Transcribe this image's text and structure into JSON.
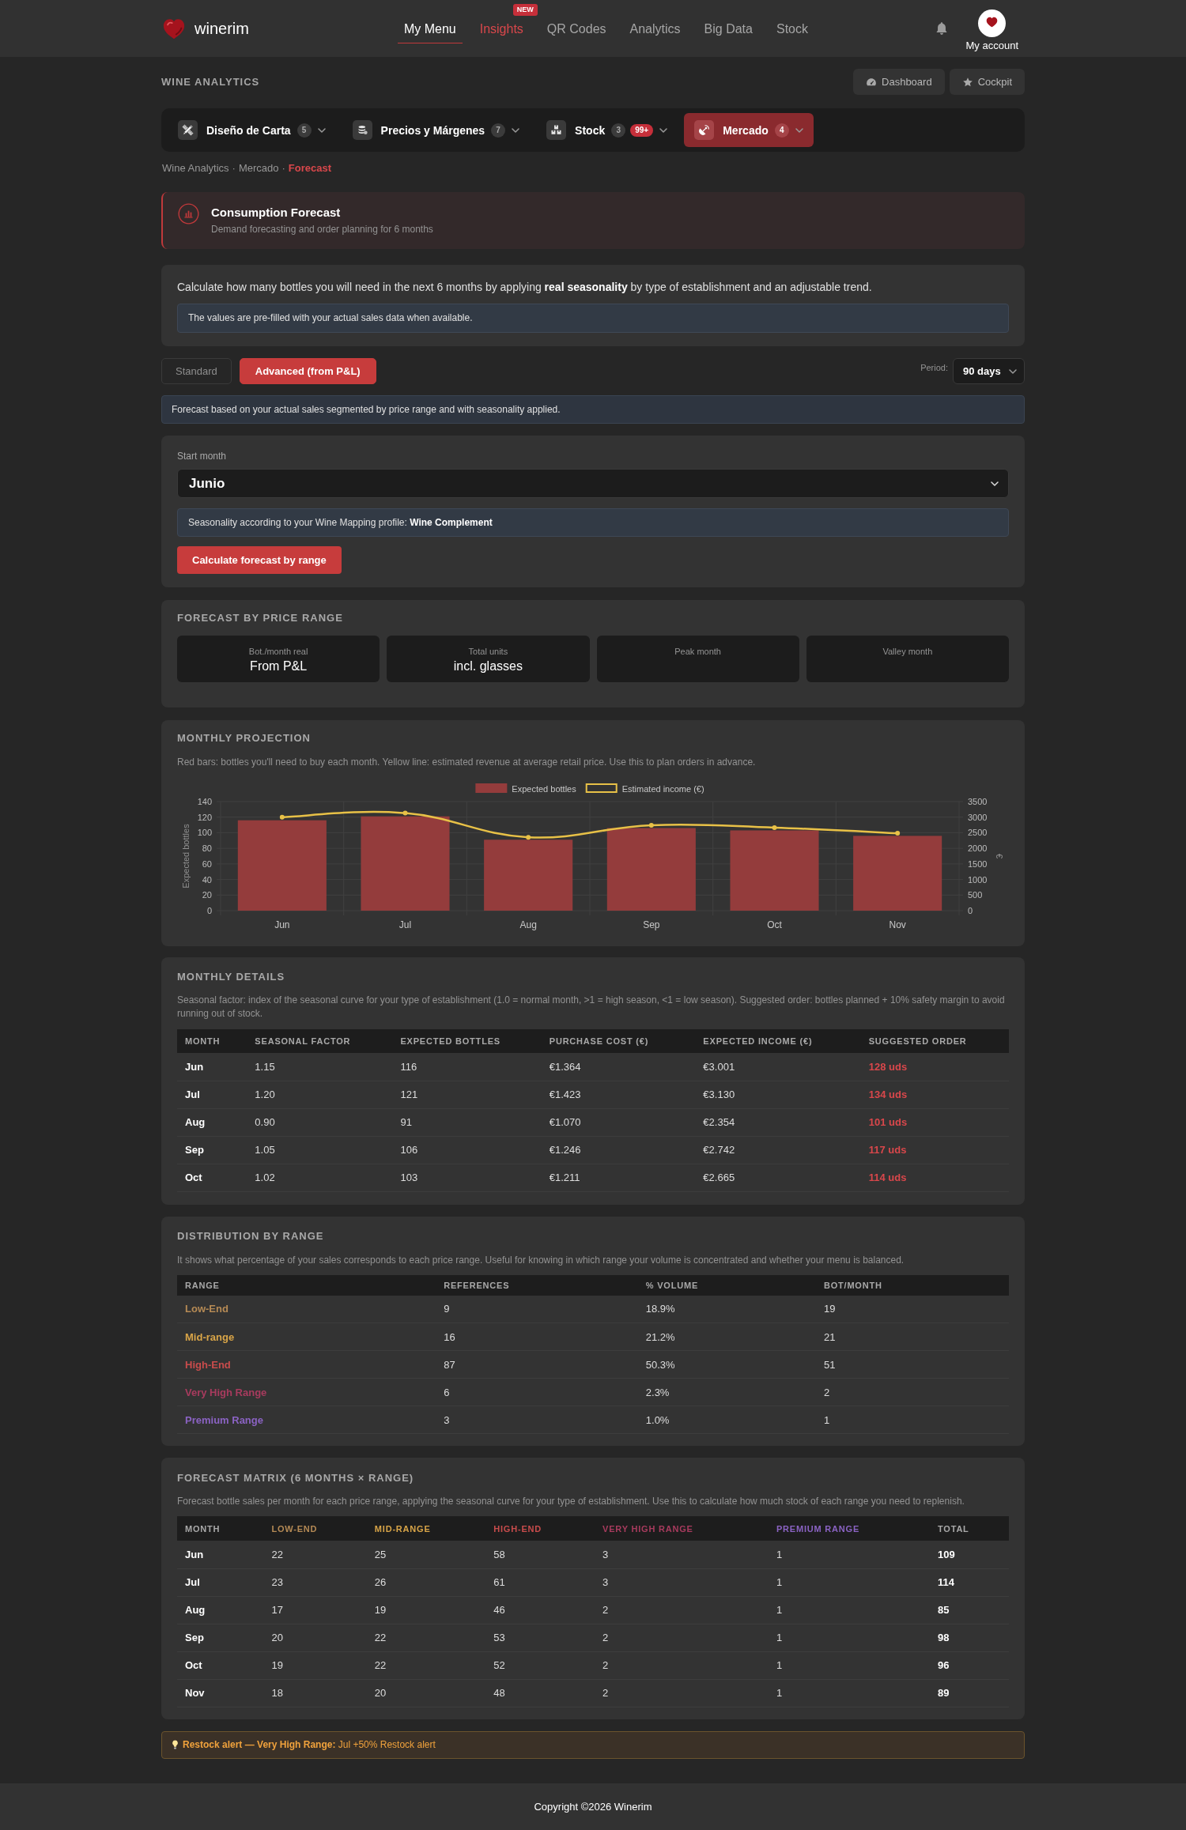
{
  "header": {
    "brand": "winerim",
    "nav": [
      {
        "label": "My Menu",
        "selected": true
      },
      {
        "label": "Insights",
        "selected": false,
        "badge": "NEW"
      },
      {
        "label": "QR Codes",
        "selected": false
      },
      {
        "label": "Analytics",
        "selected": false
      },
      {
        "label": "Big Data",
        "selected": false
      },
      {
        "label": "Stock",
        "selected": false
      }
    ],
    "account": "My account"
  },
  "section": {
    "title": "WINE ANALYTICS",
    "actions": [
      "Dashboard",
      "Cockpit"
    ]
  },
  "tabs": [
    {
      "label": "Diseño de Carta",
      "count": "5",
      "selected": false
    },
    {
      "label": "Precios y Márgenes",
      "count": "7",
      "selected": false
    },
    {
      "label": "Stock",
      "count": "3",
      "alert": "99+",
      "selected": false
    },
    {
      "label": "Mercado",
      "count": "4",
      "selected": true
    }
  ],
  "breadcrumb": {
    "separator": "·",
    "items": [
      {
        "label": "Wine Analytics",
        "current": false
      },
      {
        "label": "Mercado",
        "current": false
      },
      {
        "label": "Forecast",
        "current": true
      }
    ]
  },
  "page_header": {
    "title": "Consumption Forecast",
    "subtitle": "Demand forecasting and order planning for 6 months"
  },
  "intro": {
    "text": "Calculate how many bottles you will need in the next 6 months by applying **real seasonality** by type of establishment and an adjustable trend.",
    "note": "The values are pre-filled with your actual sales data when available."
  },
  "modes": [
    {
      "label": "Standard",
      "selected": false
    },
    {
      "label": "Advanced (from P&L)",
      "selected": true
    }
  ],
  "period": {
    "label": "Period:",
    "value": "90 days"
  },
  "mode_note": "Forecast based on your actual sales segmented by price range and with seasonality applied.",
  "start_month": {
    "label": "Start month",
    "value": "Junio",
    "note": "Seasonality according to your Wine Mapping profile: **Wine Complement**",
    "button": "Calculate forecast by range"
  },
  "price_range": {
    "title": "FORECAST BY PRICE RANGE",
    "stats": [
      {
        "label": "Bot./month real",
        "value": "From P&L"
      },
      {
        "label": "Total units",
        "value": "incl. glasses"
      },
      {
        "label": "Peak month"
      },
      {
        "label": "Valley month"
      }
    ]
  },
  "projection": {
    "title": "MONTHLY PROJECTION",
    "description": "Red bars: bottles you'll need to buy each month. Yellow line: estimated revenue at average retail price. Use this to plan orders in advance.",
    "chart_data": {
      "type": "bar",
      "grid": true,
      "legend": true,
      "categories": [
        "Jun",
        "Jul",
        "Aug",
        "Sep",
        "Oct",
        "Nov"
      ],
      "ylabel": "Expected bottles",
      "ylim": [
        0,
        140
      ],
      "yticks": [
        0,
        20,
        40,
        60,
        80,
        100,
        120,
        140
      ],
      "y2label": "€",
      "y2lim": [
        0,
        3500
      ],
      "y2ticks": [
        0,
        500,
        1000,
        1500,
        2000,
        2500,
        3000,
        3500
      ],
      "series": [
        {
          "name": "Expected bottles",
          "color": "#943c3c",
          "values": [
            116,
            121,
            91,
            106,
            103,
            96
          ]
        },
        {
          "name": "Estimated income (€)",
          "type": "line",
          "axis": "y2",
          "marker": "circle",
          "color": "#e8c147",
          "values": [
            3001,
            3130,
            2354,
            2742,
            2665,
            2484
          ]
        }
      ]
    }
  },
  "monthly_details": {
    "title": "MONTHLY DETAILS",
    "description": "Seasonal factor: index of the seasonal curve for your type of establishment (1.0 = normal month, >1 = high season, <1 = low season). Suggested order: bottles planned + 10% safety margin to avoid running out of stock.",
    "columns": [
      "MONTH",
      "SEASONAL FACTOR",
      "EXPECTED BOTTLES",
      "PURCHASE COST (€)",
      "EXPECTED INCOME (€)",
      "SUGGESTED ORDER"
    ],
    "rows": [
      [
        "Jun",
        "1.15",
        "116",
        "€1.364",
        "€3.001",
        "128 uds"
      ],
      [
        "Jul",
        "1.20",
        "121",
        "€1.423",
        "€3.130",
        "134 uds"
      ],
      [
        "Aug",
        "0.90",
        "91",
        "€1.070",
        "€2.354",
        "101 uds"
      ],
      [
        "Sep",
        "1.05",
        "106",
        "€1.246",
        "€2.742",
        "117 uds"
      ],
      [
        "Oct",
        "1.02",
        "103",
        "€1.211",
        "€2.665",
        "114 uds"
      ]
    ]
  },
  "distribution": {
    "title": "DISTRIBUTION BY RANGE",
    "description": "It shows what percentage of your sales corresponds to each price range. Useful for knowing in which range your volume is concentrated and whether your menu is balanced.",
    "columns": [
      "RANGE",
      "REFERENCES",
      "% VOLUME",
      "BOT/MONTH"
    ],
    "rows": [
      {
        "cells": [
          "Low-End",
          "9",
          "18.9%",
          "19"
        ],
        "color": "#b58a55"
      },
      {
        "cells": [
          "Mid-range",
          "16",
          "21.2%",
          "21"
        ],
        "color": "#d9a548"
      },
      {
        "cells": [
          "High-End",
          "87",
          "50.3%",
          "51"
        ],
        "color": "#c94c4c"
      },
      {
        "cells": [
          "Very High Range",
          "6",
          "2.3%",
          "2"
        ],
        "color": "#a83b5e"
      },
      {
        "cells": [
          "Premium Range",
          "3",
          "1.0%",
          "1"
        ],
        "color": "#8b63c4"
      }
    ]
  },
  "matrix": {
    "title": "FORECAST MATRIX (6 MONTHS × RANGE)",
    "description": "Forecast bottle sales per month for each price range, applying the seasonal curve for your type of establishment. Use this to calculate how much stock of each range you need to replenish.",
    "columns": [
      {
        "label": "MONTH"
      },
      {
        "label": "LOW-END",
        "color": "#b58a55"
      },
      {
        "label": "MID-RANGE",
        "color": "#d9a548"
      },
      {
        "label": "HIGH-END",
        "color": "#c94c4c"
      },
      {
        "label": "VERY HIGH RANGE",
        "color": "#a83b5e"
      },
      {
        "label": "PREMIUM RANGE",
        "color": "#8b63c4"
      },
      {
        "label": "TOTAL"
      }
    ],
    "rows": [
      [
        "Jun",
        "22",
        "25",
        "58",
        "3",
        "1",
        "109"
      ],
      [
        "Jul",
        "23",
        "26",
        "61",
        "3",
        "1",
        "114"
      ],
      [
        "Aug",
        "17",
        "19",
        "46",
        "2",
        "1",
        "85"
      ],
      [
        "Sep",
        "20",
        "22",
        "53",
        "2",
        "1",
        "98"
      ],
      [
        "Oct",
        "19",
        "22",
        "52",
        "2",
        "1",
        "96"
      ],
      [
        "Nov",
        "18",
        "20",
        "48",
        "2",
        "1",
        "89"
      ]
    ]
  },
  "alert": {
    "text": "**Restock alert — Very High Range:** Jul +50% Restock alert"
  },
  "footer": "Copyright ©2026 Winerim"
}
